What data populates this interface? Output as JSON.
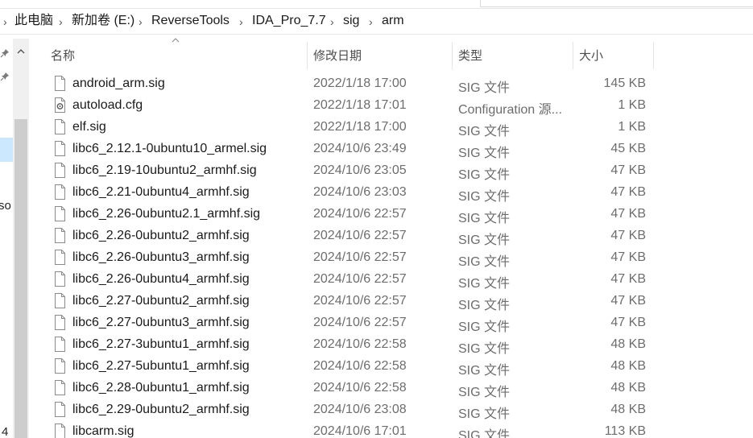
{
  "breadcrumb": [
    "此电脑",
    "新加卷 (E:)",
    "ReverseTools",
    "IDA_Pro_7.7",
    "sig",
    "arm"
  ],
  "nav": {
    "partial_label_1": "so",
    "partial_label_2": "4"
  },
  "columns": {
    "name": "名称",
    "date": "修改日期",
    "type": "类型",
    "size": "大小"
  },
  "files": [
    {
      "name": "android_arm.sig",
      "date": "2022/1/18 17:00",
      "type": "SIG 文件",
      "size": "145 KB",
      "icon": "file-icon"
    },
    {
      "name": "autoload.cfg",
      "date": "2022/1/18 17:01",
      "type": "Configuration 源...",
      "size": "1 KB",
      "icon": "config-file-icon"
    },
    {
      "name": "elf.sig",
      "date": "2022/1/18 17:00",
      "type": "SIG 文件",
      "size": "1 KB",
      "icon": "file-icon"
    },
    {
      "name": "libc6_2.12.1-0ubuntu10_armel.sig",
      "date": "2024/10/6 23:49",
      "type": "SIG 文件",
      "size": "45 KB",
      "icon": "file-icon"
    },
    {
      "name": "libc6_2.19-10ubuntu2_armhf.sig",
      "date": "2024/10/6 23:05",
      "type": "SIG 文件",
      "size": "47 KB",
      "icon": "file-icon"
    },
    {
      "name": "libc6_2.21-0ubuntu4_armhf.sig",
      "date": "2024/10/6 23:03",
      "type": "SIG 文件",
      "size": "47 KB",
      "icon": "file-icon"
    },
    {
      "name": "libc6_2.26-0ubuntu2.1_armhf.sig",
      "date": "2024/10/6 22:57",
      "type": "SIG 文件",
      "size": "47 KB",
      "icon": "file-icon"
    },
    {
      "name": "libc6_2.26-0ubuntu2_armhf.sig",
      "date": "2024/10/6 22:57",
      "type": "SIG 文件",
      "size": "47 KB",
      "icon": "file-icon"
    },
    {
      "name": "libc6_2.26-0ubuntu3_armhf.sig",
      "date": "2024/10/6 22:57",
      "type": "SIG 文件",
      "size": "47 KB",
      "icon": "file-icon"
    },
    {
      "name": "libc6_2.26-0ubuntu4_armhf.sig",
      "date": "2024/10/6 22:57",
      "type": "SIG 文件",
      "size": "47 KB",
      "icon": "file-icon"
    },
    {
      "name": "libc6_2.27-0ubuntu2_armhf.sig",
      "date": "2024/10/6 22:57",
      "type": "SIG 文件",
      "size": "47 KB",
      "icon": "file-icon"
    },
    {
      "name": "libc6_2.27-0ubuntu3_armhf.sig",
      "date": "2024/10/6 22:57",
      "type": "SIG 文件",
      "size": "47 KB",
      "icon": "file-icon"
    },
    {
      "name": "libc6_2.27-3ubuntu1_armhf.sig",
      "date": "2024/10/6 22:58",
      "type": "SIG 文件",
      "size": "48 KB",
      "icon": "file-icon"
    },
    {
      "name": "libc6_2.27-5ubuntu1_armhf.sig",
      "date": "2024/10/6 22:58",
      "type": "SIG 文件",
      "size": "48 KB",
      "icon": "file-icon"
    },
    {
      "name": "libc6_2.28-0ubuntu1_armhf.sig",
      "date": "2024/10/6 22:58",
      "type": "SIG 文件",
      "size": "48 KB",
      "icon": "file-icon"
    },
    {
      "name": "libc6_2.29-0ubuntu2_armhf.sig",
      "date": "2024/10/6 23:08",
      "type": "SIG 文件",
      "size": "48 KB",
      "icon": "file-icon"
    },
    {
      "name": "libcarm.sig",
      "date": "2024/10/6 17:01",
      "type": "SIG 文件",
      "size": "113 KB",
      "icon": "file-icon"
    }
  ]
}
